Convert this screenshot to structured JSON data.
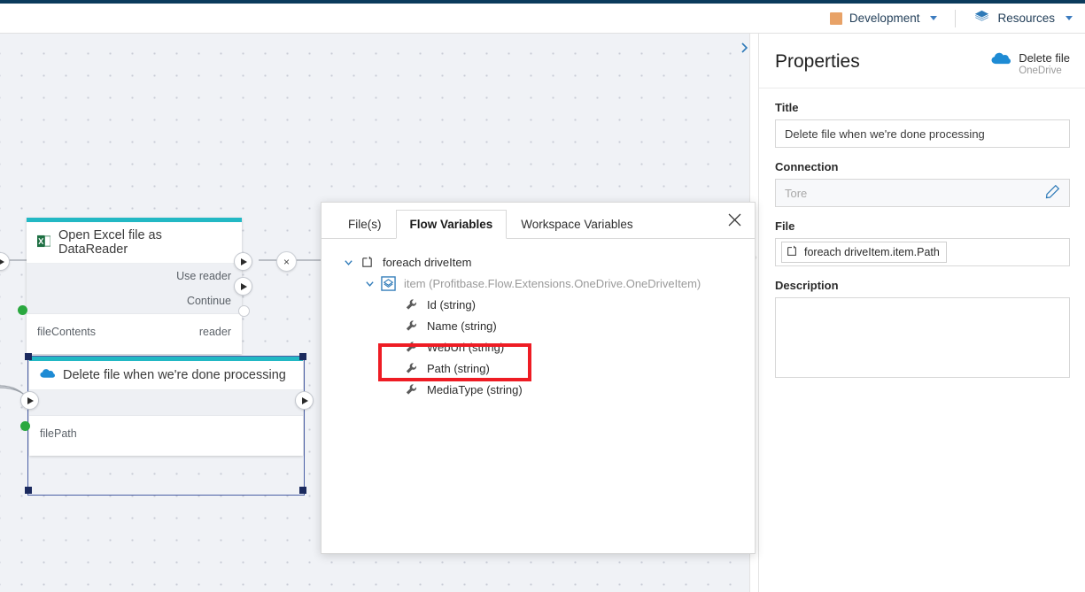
{
  "topbar": {
    "environment": "Development",
    "environment_color": "#e8a267",
    "resources": "Resources"
  },
  "canvas": {
    "nodes": [
      {
        "title": "Open Excel file as DataReader",
        "icon": "excel-icon",
        "exec_outputs": [
          "Use reader",
          "Continue"
        ],
        "input_var": "fileContents",
        "output_var": "reader",
        "selected": false
      },
      {
        "title": "Delete file when we're done processing",
        "icon": "onedrive-icon",
        "exec_outputs": [],
        "input_var": "filePath",
        "output_var": "",
        "selected": true
      }
    ],
    "connector_delete_label": "×"
  },
  "dialog": {
    "tabs": [
      {
        "label": "File(s)",
        "active": false
      },
      {
        "label": "Flow Variables",
        "active": true
      },
      {
        "label": "Workspace Variables",
        "active": false
      }
    ],
    "close_label": "✕",
    "tree": [
      {
        "label": "foreach driveItem",
        "level": 1,
        "icon": "scope-icon",
        "expanded": true,
        "tone": "dark",
        "highlighted": false
      },
      {
        "label": "item (Profitbase.Flow.Extensions.OneDrive.OneDriveItem)",
        "level": 2,
        "icon": "object-icon",
        "expanded": true,
        "tone": "grey",
        "highlighted": false
      },
      {
        "label": "Id (string)",
        "level": 3,
        "icon": "wrench-icon",
        "expanded": false,
        "tone": "dark",
        "highlighted": false
      },
      {
        "label": "Name (string)",
        "level": 3,
        "icon": "wrench-icon",
        "expanded": false,
        "tone": "dark",
        "highlighted": false
      },
      {
        "label": "WebUrl (string)",
        "level": 3,
        "icon": "wrench-icon",
        "expanded": false,
        "tone": "dark",
        "highlighted": false
      },
      {
        "label": "Path (string)",
        "level": 3,
        "icon": "wrench-icon",
        "expanded": false,
        "tone": "dark",
        "highlighted": true
      },
      {
        "label": "MediaType (string)",
        "level": 3,
        "icon": "wrench-icon",
        "expanded": false,
        "tone": "dark",
        "highlighted": false
      }
    ],
    "highlight_color": "#ee1c24"
  },
  "properties": {
    "heading": "Properties",
    "node_name": "Delete file",
    "node_source": "OneDrive",
    "title_label": "Title",
    "title_value": "Delete file when we're done processing",
    "connection_label": "Connection",
    "connection_placeholder": "Tore",
    "file_label": "File",
    "file_token": "foreach driveItem.item.Path",
    "description_label": "Description",
    "description_value": ""
  }
}
